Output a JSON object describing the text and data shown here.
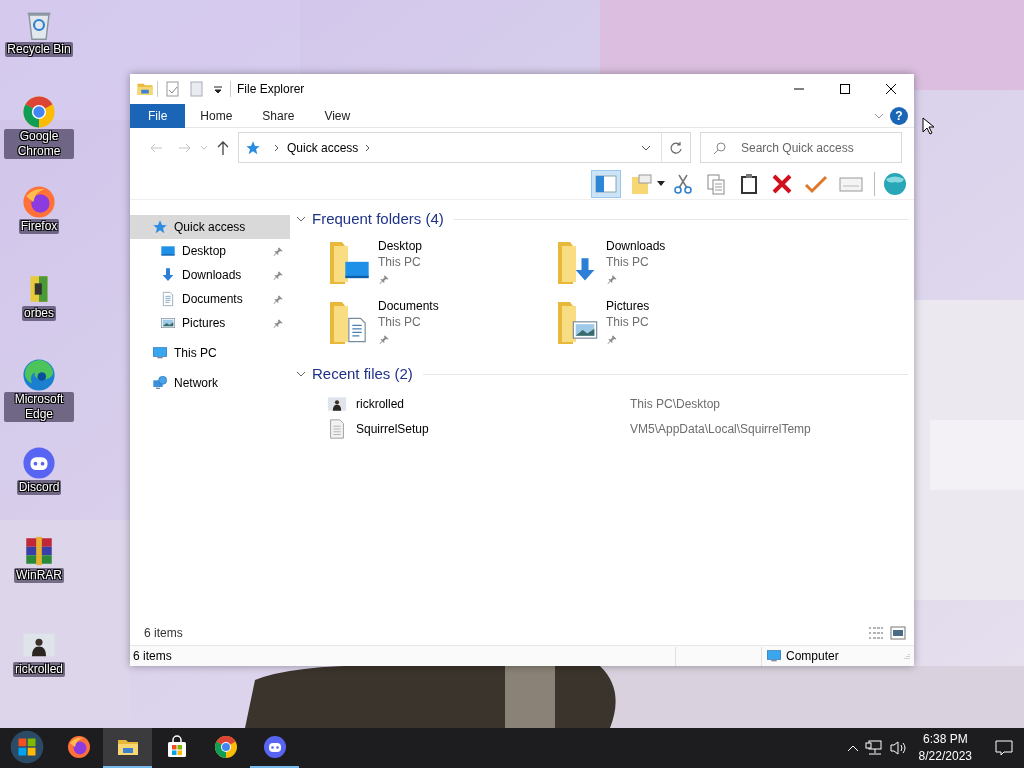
{
  "desktop_icons": [
    {
      "label": "Recycle Bin",
      "kind": "recycle"
    },
    {
      "label": "Google Chrome",
      "kind": "chrome"
    },
    {
      "label": "Firefox",
      "kind": "firefox"
    },
    {
      "label": "orbes",
      "kind": "orbes"
    },
    {
      "label": "Microsoft Edge",
      "kind": "edge"
    },
    {
      "label": "Discord",
      "kind": "discord"
    },
    {
      "label": "WinRAR",
      "kind": "winrar"
    },
    {
      "label": "rickrolled"
    }
  ],
  "window": {
    "title": "File Explorer"
  },
  "ribbon_tabs": [
    {
      "label": "File",
      "kind": "file"
    },
    {
      "label": "Home",
      "kind": "tab"
    },
    {
      "label": "Share",
      "kind": "tab"
    },
    {
      "label": "View",
      "kind": "tab"
    }
  ],
  "help_button": {
    "label": "?"
  },
  "address_bar": {
    "crumbs": [
      "Quick access"
    ]
  },
  "search": {
    "placeholder": "Search Quick access"
  },
  "navigation": [
    {
      "label": "Quick access",
      "kind": "star",
      "selected": true,
      "children": [
        {
          "label": "Desktop",
          "kind": "desktop",
          "pinned": true,
          "selected": false
        },
        {
          "label": "Downloads",
          "kind": "downloads",
          "pinned": true,
          "selected": false
        },
        {
          "label": "Documents",
          "kind": "documents",
          "pinned": true,
          "selected": false
        },
        {
          "label": "Pictures",
          "kind": "pictures",
          "pinned": true,
          "selected": false
        }
      ]
    },
    {
      "label": "This PC",
      "kind": "pc",
      "selected": false
    },
    {
      "label": "Network",
      "kind": "network",
      "selected": false
    }
  ],
  "sections": [
    {
      "title": "Frequent folders (4)",
      "expanded": true,
      "kind": "folders",
      "items": [
        {
          "name": "Desktop",
          "location": "This PC",
          "kind": "desktop",
          "pinned": true
        },
        {
          "name": "Downloads",
          "location": "This PC",
          "kind": "downloads",
          "pinned": true
        },
        {
          "name": "Documents",
          "location": "This PC",
          "kind": "documents",
          "pinned": true
        },
        {
          "name": "Pictures",
          "location": "This PC",
          "kind": "pictures",
          "pinned": true
        }
      ]
    },
    {
      "title": "Recent files (2)",
      "expanded": true,
      "kind": "files",
      "items": [
        {
          "name": "rickrolled",
          "path": "This PC\\Desktop"
        },
        {
          "name": "SquirrelSetup",
          "path": "VM5\\AppData\\Local\\SquirrelTemp",
          "kind": "document"
        }
      ]
    }
  ],
  "item_count": "6 items",
  "status_bar": {
    "items": "6 items",
    "zone": "Computer"
  },
  "taskbar": {
    "apps": [
      {
        "kind": "firefox",
        "running": false,
        "selected": false
      },
      {
        "kind": "explorer",
        "running": true,
        "selected": true
      },
      {
        "kind": "store",
        "running": false,
        "selected": false
      },
      {
        "kind": "chrome",
        "running": false,
        "selected": false
      },
      {
        "kind": "discord",
        "running": true,
        "selected": false
      }
    ],
    "clock": {
      "time": "6:38 PM",
      "date": "8/22/2023"
    }
  }
}
